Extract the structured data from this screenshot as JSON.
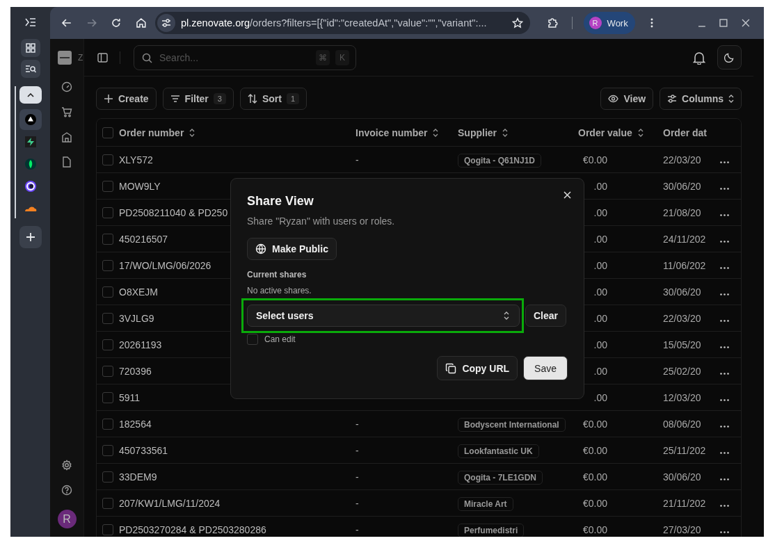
{
  "browser": {
    "tabs": [
      {
        "kind": "triangle",
        "selected": true
      },
      {
        "kind": "bolt",
        "selected": false
      },
      {
        "kind": "leaf",
        "selected": false
      },
      {
        "kind": "ring",
        "selected": false
      },
      {
        "kind": "cloud",
        "selected": false
      }
    ],
    "nav": [
      {
        "kind": "back",
        "disabled": false
      },
      {
        "kind": "forward",
        "disabled": true
      },
      {
        "kind": "reload",
        "disabled": false
      },
      {
        "kind": "home",
        "disabled": false
      }
    ],
    "address": {
      "host": "pl.zenovate.org",
      "path": "/orders?filters=[{\"id\":\"createdAt\",\"value\":\"\",\"variant\":..."
    },
    "profile": {
      "initial": "R",
      "name": "Work"
    }
  },
  "app": {
    "name": "Z",
    "search": {
      "placeholder": "Search...",
      "keys": [
        "⌘",
        "K"
      ]
    },
    "toolbar": {
      "left": [
        {
          "kind": "create",
          "label": "Create"
        },
        {
          "kind": "filter",
          "label": "Filter",
          "count": "3"
        },
        {
          "kind": "sort",
          "label": "Sort",
          "count": "1"
        }
      ],
      "right": [
        {
          "kind": "view",
          "label": "View"
        },
        {
          "kind": "columns",
          "label": "Columns"
        }
      ]
    },
    "table": {
      "all_checked": false,
      "columns": [
        "Order number",
        "Invoice number",
        "Supplier",
        "Order value",
        "Order dat"
      ],
      "rows": [
        {
          "checked": false,
          "order_number": "XLY572",
          "invoice_number": "-",
          "supplier": "Qogita - Q61NJ1D",
          "order_value": "€0.00",
          "order_date": "22/03/20"
        },
        {
          "checked": false,
          "order_number": "MOW9LY",
          "order_value": ".00",
          "order_date": "30/06/20"
        },
        {
          "checked": false,
          "order_number": "PD2508211040 & PD250",
          "order_value": ".00",
          "order_date": "21/08/20"
        },
        {
          "checked": false,
          "order_number": "450216507",
          "order_value": ".00",
          "order_date": "24/11/202"
        },
        {
          "checked": false,
          "order_number": "17/WO/LMG/06/2026",
          "order_value": ".00",
          "order_date": "11/06/202"
        },
        {
          "checked": false,
          "order_number": "O8XEJM",
          "order_value": ".00",
          "order_date": "30/06/20"
        },
        {
          "checked": false,
          "order_number": "3VJLG9",
          "order_value": ".00",
          "order_date": "22/03/20"
        },
        {
          "checked": false,
          "order_number": "20261193",
          "order_value": ".00",
          "order_date": "15/05/20"
        },
        {
          "checked": false,
          "order_number": "720396",
          "order_value": ".00",
          "order_date": "25/02/20"
        },
        {
          "checked": false,
          "order_number": "5911",
          "order_value": ".00",
          "order_date": "12/03/20"
        },
        {
          "checked": false,
          "order_number": "182564",
          "invoice_number": "-",
          "supplier": "Bodyscent International",
          "order_value": "€0.00",
          "order_date": "08/06/20"
        },
        {
          "checked": false,
          "order_number": "450733561",
          "invoice_number": "-",
          "supplier": "Lookfantastic UK",
          "order_value": "€0.00",
          "order_date": "25/11/202"
        },
        {
          "checked": false,
          "order_number": "33DEM9",
          "invoice_number": "-",
          "supplier": "Qogita - 7LE1GDN",
          "order_value": "€0.00",
          "order_date": "30/06/20"
        },
        {
          "checked": false,
          "order_number": "207/KW1/LMG/11/2024",
          "invoice_number": "-",
          "supplier": "Miracle Art",
          "order_value": "€0.00",
          "order_date": "21/11/202"
        },
        {
          "checked": false,
          "order_number": "PD2503270284 & PD2503280286",
          "invoice_number": "-",
          "supplier": "Perfumedistri",
          "order_value": "€0.00",
          "order_date": "27/03/20"
        }
      ]
    },
    "user_initial": "R"
  },
  "dialog": {
    "title": "Share View",
    "subtitle": "Share \"Ryzan\" with users or roles.",
    "make_public": "Make Public",
    "current_shares_label": "Current shares",
    "empty_text": "No active shares.",
    "select": {
      "placeholder": "Select users",
      "highlighted": true
    },
    "clear": "Clear",
    "can_edit": {
      "label": "Can edit",
      "checked": false
    },
    "copy_url": "Copy URL",
    "save": "Save"
  }
}
